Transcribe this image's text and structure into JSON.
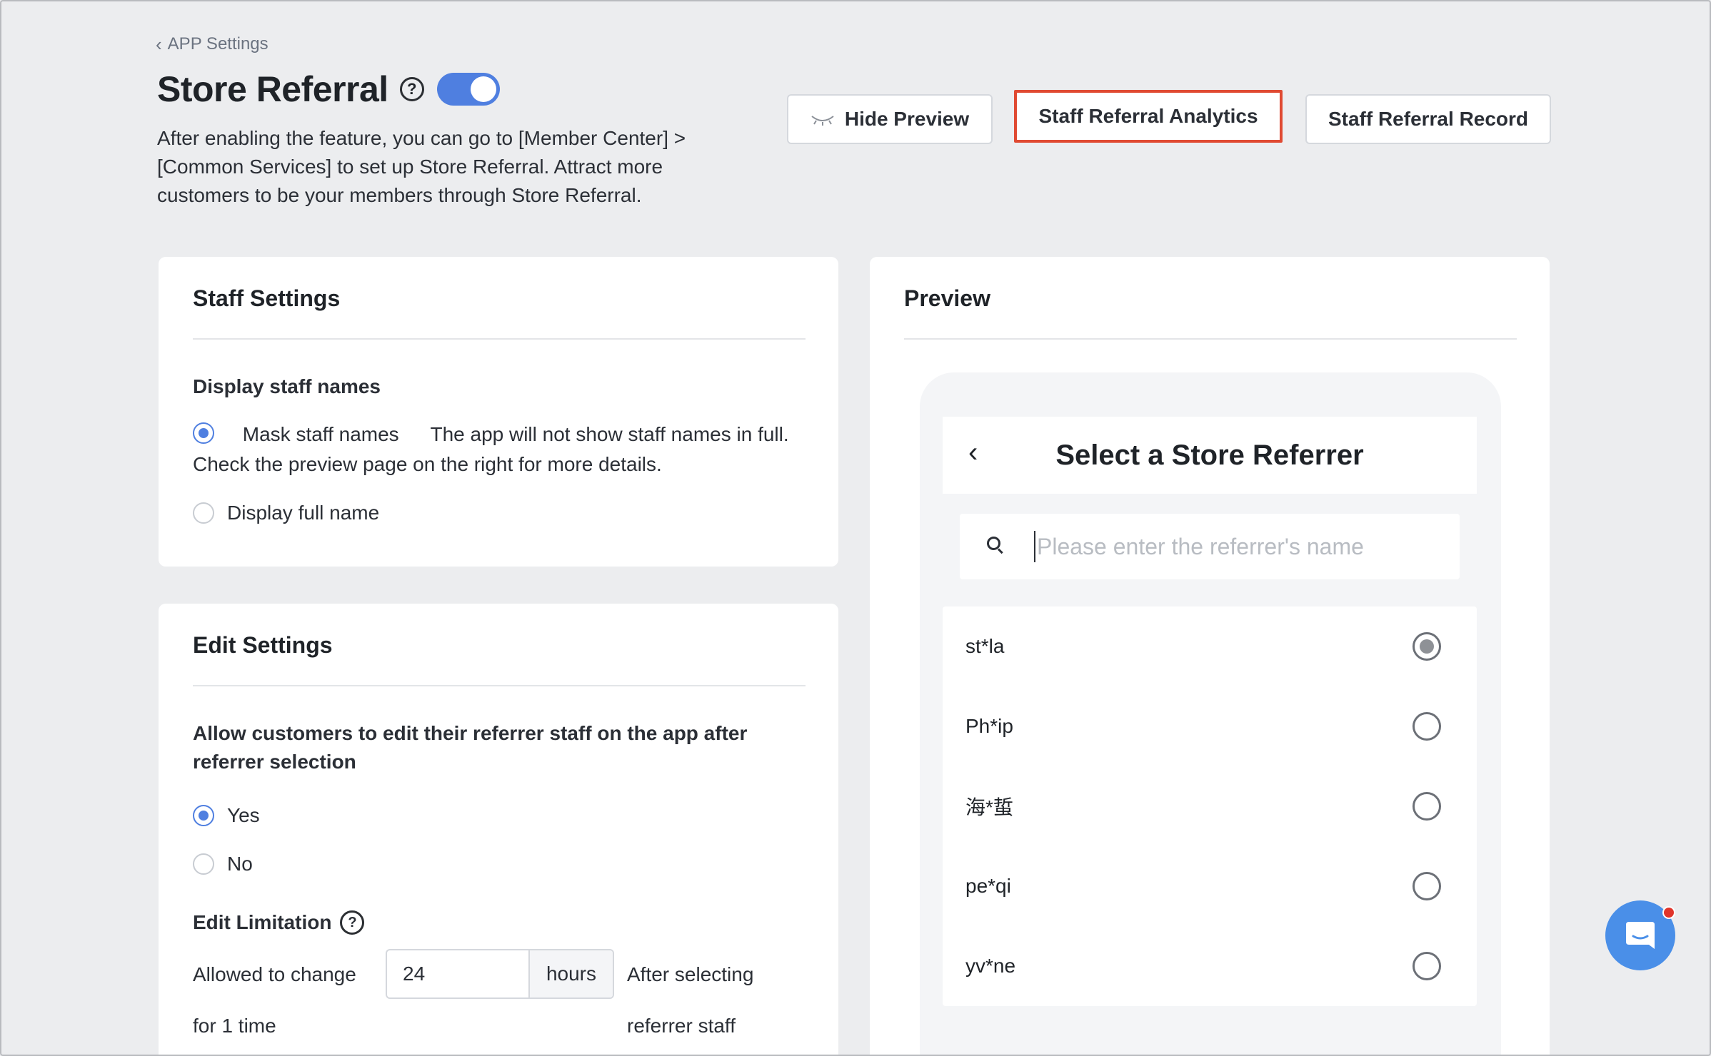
{
  "breadcrumb": {
    "label": "APP Settings"
  },
  "header": {
    "title": "Store Referral",
    "description": "After enabling the feature, you can go to [Member Center] > [Common Services] to set up Store Referral. Attract more customers to be your members through Store Referral.",
    "toggle_on": true
  },
  "actions": {
    "hide_preview": "Hide Preview",
    "analytics": "Staff Referral Analytics",
    "record": "Staff Referral Record"
  },
  "staff_settings": {
    "title": "Staff Settings",
    "display_label": "Display staff names",
    "mask_option": "Mask staff names",
    "mask_desc": "The app will not show staff names in full. Check the preview page on the right for more details.",
    "full_option": "Display full name",
    "selected": "mask"
  },
  "edit_settings": {
    "title": "Edit Settings",
    "allow_label": "Allow customers to edit their referrer staff on the app after referrer selection",
    "yes": "Yes",
    "no": "No",
    "selected": "yes",
    "limitation_label": "Edit Limitation",
    "allowed_prefix_1": "Allowed to change",
    "allowed_prefix_2": "for 1 time",
    "hours_value": "24",
    "hours_unit": "hours",
    "after_1": "After selecting",
    "after_2": "referrer staff"
  },
  "preview": {
    "title": "Preview",
    "phone_title": "Select a Store Referrer",
    "search_placeholder": "Please enter the referrer's name",
    "items": [
      {
        "name": "st*la",
        "selected": true
      },
      {
        "name": "Ph*ip",
        "selected": false
      },
      {
        "name": "海*蜇",
        "selected": false
      },
      {
        "name": "pe*qi",
        "selected": false
      },
      {
        "name": "yv*ne",
        "selected": false
      }
    ]
  },
  "colors": {
    "accent": "#4f7fe0",
    "highlight_border": "#e04a32",
    "chat_button": "#4a8fe8",
    "notification_dot": "#e0352b"
  }
}
